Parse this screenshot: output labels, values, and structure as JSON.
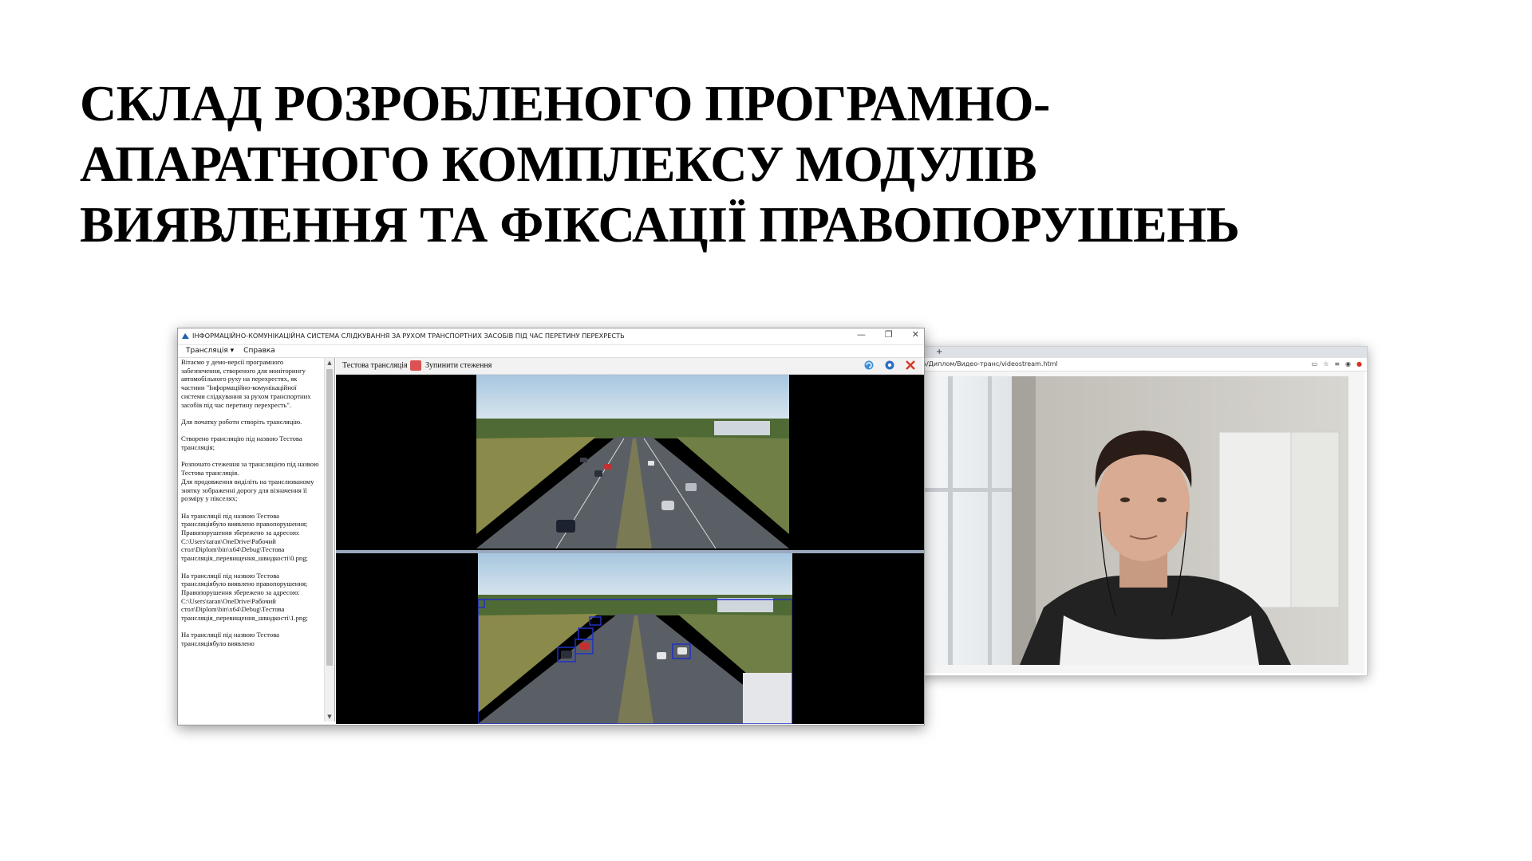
{
  "slide": {
    "title_lines": [
      "СКЛАД РОЗРОБЛЕНОГО ПРОГРАМНО-",
      "АПАРАТНОГО КОМПЛЕКСУ МОДУЛІВ",
      "ВИЯВЛЕННЯ ТА ФІКСАЦІЇ ПРАВОПОРУШЕНЬ"
    ]
  },
  "app_window": {
    "title": "ІНФОРМАЦІЙНО-КОМУНІКАЦІЙНА СИСТЕМА СЛІДКУВАННЯ ЗА РУХОМ ТРАНСПОРТНИХ ЗАСОБІВ ПІД ЧАС ПЕРЕТИНУ ПЕРЕХРЕСТЬ",
    "controls": {
      "minimize": "—",
      "restore": "❐",
      "close": "✕"
    },
    "menu": {
      "stream": "Трансляція",
      "stream_arrow": "▾",
      "help": "Справка"
    },
    "toolbar": {
      "stream_name": "Тестова трансляція",
      "stop_label": "Зупинити стеження",
      "icons": [
        "refresh-icon",
        "settings-icon",
        "close-icon"
      ]
    },
    "scroll": {
      "up": "▲",
      "down": "▼"
    },
    "log": [
      "Вітаємо у демо-версії програмного забезпечення, створеного для моніторингу автомобільного руху на перехрестях, як частини \"Інформаційно-комунікаційної системи слідкування за рухом транспортних засобів під час перетину перехресть\".",
      "Для початку роботи створіть трансляцію.",
      "Створено трансляцію під назвою Тестова трансляція;",
      "Розпочато стеження за трансляцією під назвою Тестова трансляція.\nДля продовження виділіть на транслюваному знятку зображенні дорогу для візначення її розміру у пікселях;",
      "На трансляції під назвою Тестова трансляціябуло виявлено правопорушення;\nПравопорушення збережено за адресою: C:\\Users\\taran\\OneDrive\\Рабочий стол\\Diplom\\bin\\x64\\Debug\\Тестова трансляція_перевищення_швидкості\\0.png;",
      "На трансляції під назвою Тестова трансляціябуло виявлено правопорушення;\nПравопорушення збережено за адресою: C:\\Users\\taran\\OneDrive\\Рабочий стол\\Diplom\\bin\\x64\\Debug\\Тестова трансляція_перевищення_швидкості\\1.png;",
      "На трансляції під назвою Тестова трансляціябуло виявлено"
    ]
  },
  "browser": {
    "new_tab": "+",
    "url": "...№/Диплом/Видео-транс/videostream.html",
    "icons": [
      "cast-icon",
      "star-icon",
      "extensions-icon",
      "account-icon",
      "menu-icon"
    ],
    "icon_glyphs": [
      "▭",
      "☆",
      "≡",
      "◉",
      "●"
    ]
  },
  "colors": {
    "stop_button": "#dc5252",
    "detection_box": "#2030c8",
    "split_line": "#9aa8bd"
  }
}
